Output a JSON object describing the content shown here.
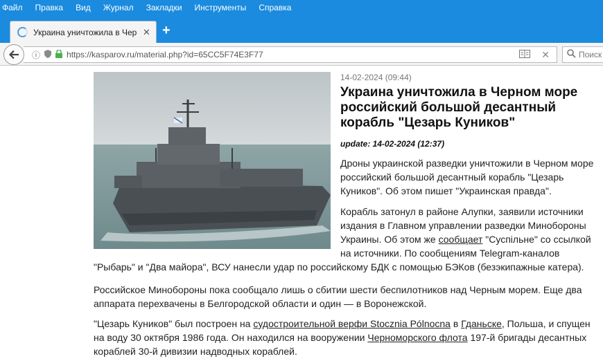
{
  "menu": [
    "Файл",
    "Правка",
    "Вид",
    "Журнал",
    "Закладки",
    "Инструменты",
    "Справка"
  ],
  "tab": {
    "title": "Украина уничтожила в Черн",
    "close": "✕"
  },
  "nav": {
    "url": "https://kasparov.ru/material.php?id=65CC5F74E3F77",
    "search_placeholder": "Поиск"
  },
  "article": {
    "date": "14-02-2024 (09:44)",
    "title": "Украина уничтожила в Черном море российский большой десантный корабль \"Цезарь Куников\"",
    "update": "update: 14-02-2024 (12:37)",
    "p1": "Дроны украинской разведки уничтожили в Черном море российский большой десантный корабль \"Цезарь Куников\". Об этом пишет \"Украинская правда\".",
    "p2_start": "Корабль затонул в районе Алупки, заявили источники издания в Главном управлении разведки Минобороны Украины. Об этом же ",
    "p2_link": "сообщает",
    "p2_mid": " \"Суспільне\" со ссылкой на источники. По сообщениям Telegram-каналов",
    "p2_end": "\"Рыбарь\" и \"Два майора\", ВСУ нанесли удар по российскому БДК с помощью БЭКов (безэкипажные катера).",
    "p3": "Российское Минобороны пока сообщало лишь о сбитии шести беспилотников над Черным морем. Еще два аппарата перехвачены в Белгородской области и один — в Воронежской.",
    "p4_a": "\"Цезарь Куников\" был построен на ",
    "p4_link1": "судостроительной верфи Stocznia Pólnocna",
    "p4_b": " в ",
    "p4_link2": "Гданьске",
    "p4_c": ", Польша, и спущен на воду 30 октября 1986 года. Он находился на вооружении ",
    "p4_link3": "Черноморского флота",
    "p4_d": " 197-й бригады десантных кораблей 30-й дивизии надводных кораблей."
  },
  "colors": {
    "chrome": "#1a8bde",
    "sea": "#8fa7a8",
    "sky": "#c8cfd2",
    "ship": "#4f5458"
  },
  "icons": [
    "favicon-icon",
    "close-icon",
    "plus-icon",
    "back-arrow-icon",
    "info-icon",
    "shield-icon",
    "lock-icon",
    "reader-icon",
    "stop-icon",
    "search-icon"
  ]
}
